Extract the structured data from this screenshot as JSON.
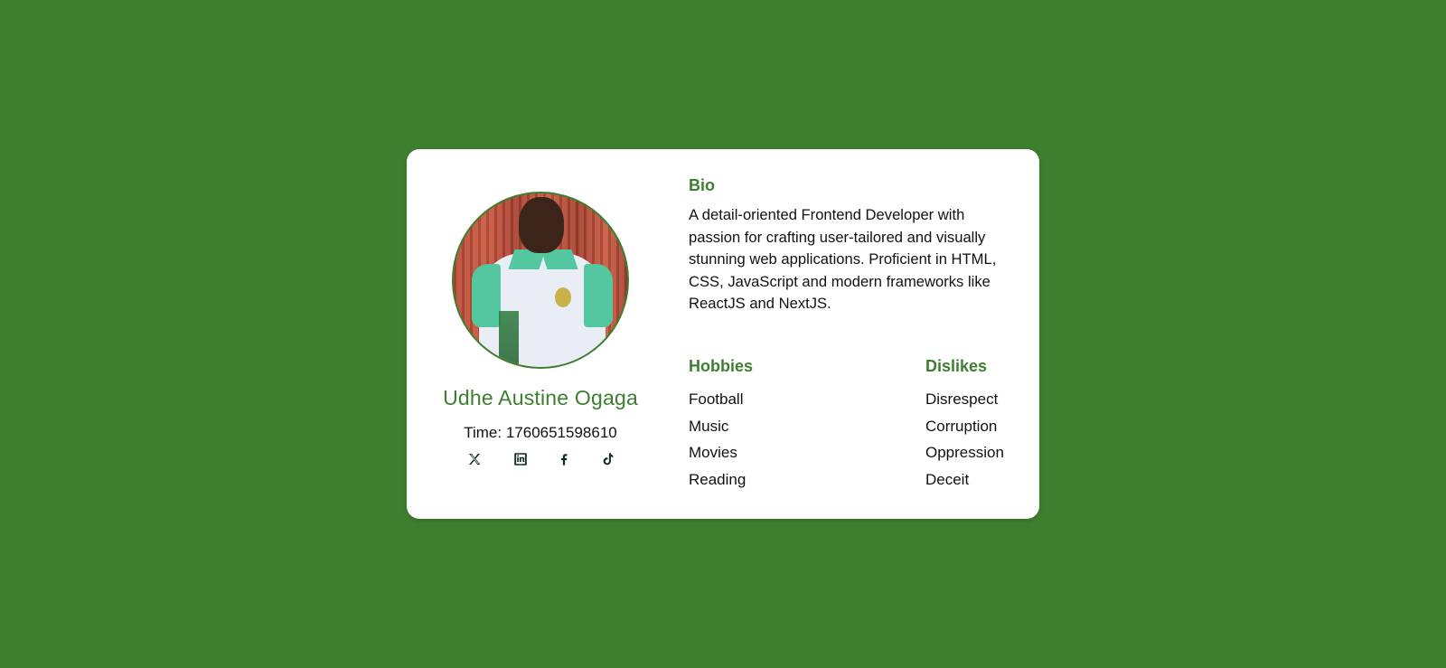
{
  "theme": {
    "background": "#3d7f2f",
    "accent": "#3d7f2f",
    "card": "#ffffff"
  },
  "profile": {
    "name": "Udhe Austine Ogaga",
    "time_label": "Time: 1760651598610",
    "avatar": "profile-photo"
  },
  "socials": [
    {
      "name": "x",
      "icon": "x-icon"
    },
    {
      "name": "linkedin",
      "icon": "linkedin-icon"
    },
    {
      "name": "facebook",
      "icon": "facebook-icon"
    },
    {
      "name": "tiktok",
      "icon": "tiktok-icon"
    }
  ],
  "bio": {
    "title": "Bio",
    "text": "A detail-oriented Frontend Developer with passion for crafting user-tailored and visually stunning web applications. Proficient in HTML, CSS, JavaScript and modern frameworks like ReactJS and NextJS."
  },
  "hobbies": {
    "title": "Hobbies",
    "items": [
      "Football",
      "Music",
      "Movies",
      "Reading"
    ]
  },
  "dislikes": {
    "title": "Dislikes",
    "items": [
      "Disrespect",
      "Corruption",
      "Oppression",
      "Deceit"
    ]
  }
}
